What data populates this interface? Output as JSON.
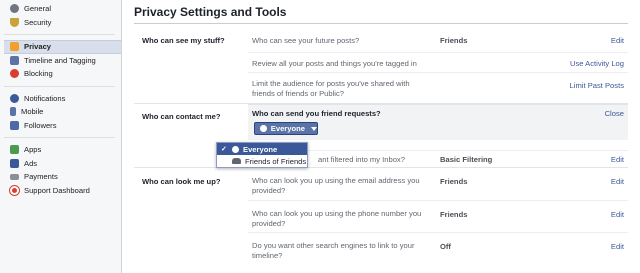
{
  "sidebar": {
    "group1": [
      {
        "label": "General",
        "icon": "gear-icon",
        "color": "#6f7680"
      },
      {
        "label": "Security",
        "icon": "shield-icon",
        "color": "#c9a23a"
      }
    ],
    "group2": [
      {
        "label": "Privacy",
        "icon": "lock-icon",
        "color": "#f0a12c",
        "active": true
      },
      {
        "label": "Timeline and Tagging",
        "icon": "timeline-icon",
        "color": "#5b74a8"
      },
      {
        "label": "Blocking",
        "icon": "block-icon",
        "color": "#d93e30"
      }
    ],
    "group3": [
      {
        "label": "Notifications",
        "icon": "globe-icon",
        "color": "#3b5998"
      },
      {
        "label": "Mobile",
        "icon": "mobile-icon",
        "color": "#5b74a8"
      },
      {
        "label": "Followers",
        "icon": "rss-icon",
        "color": "#4b6aa8"
      }
    ],
    "group4": [
      {
        "label": "Apps",
        "icon": "apps-icon",
        "color": "#4a9b4f"
      },
      {
        "label": "Ads",
        "icon": "ads-icon",
        "color": "#3b5998"
      },
      {
        "label": "Payments",
        "icon": "card-icon",
        "color": "#8a9099"
      },
      {
        "label": "Support Dashboard",
        "icon": "lifebuoy-icon",
        "color": "#d93e30"
      }
    ]
  },
  "main": {
    "title": "Privacy Settings and Tools",
    "sections": {
      "stuff": {
        "label": "Who can see my stuff?",
        "rows": [
          {
            "question": "Who can see your future posts?",
            "value": "Friends",
            "action": "Edit"
          },
          {
            "question": "Review all your posts and things you're tagged in",
            "value": "",
            "action": "Use Activity Log"
          },
          {
            "question": "Limit the audience for posts you've shared with friends of friends or Public?",
            "value": "",
            "action": "Limit Past Posts"
          }
        ]
      },
      "contact": {
        "label": "Who can contact me?",
        "expanded_question": "Who can send you friend requests?",
        "close": "Close",
        "audience_button": "Everyone",
        "rows": [
          {
            "question": "Whose messages do I want filtered into my Inbox?",
            "visible_fragment": "ant filtered into my Inbox?",
            "value": "Basic Filtering",
            "action": "Edit"
          }
        ]
      },
      "lookup": {
        "label": "Who can look me up?",
        "rows": [
          {
            "question": "Who can look you up using the email address you provided?",
            "value": "Friends",
            "action": "Edit"
          },
          {
            "question": "Who can look you up using the phone number you provided?",
            "value": "Friends",
            "action": "Edit"
          },
          {
            "question": "Do you want other search engines to link to your timeline?",
            "value": "Off",
            "action": "Edit"
          }
        ]
      }
    }
  },
  "dropdown": {
    "options": [
      {
        "label": "Everyone",
        "selected": true,
        "icon": "globe-icon"
      },
      {
        "label": "Friends of Friends",
        "selected": false,
        "icon": "friends-icon"
      }
    ],
    "check": "✓"
  },
  "colors": {
    "link": "#3b5998",
    "selected_bg": "#3b5998",
    "button_bg": "#5b74a8"
  }
}
